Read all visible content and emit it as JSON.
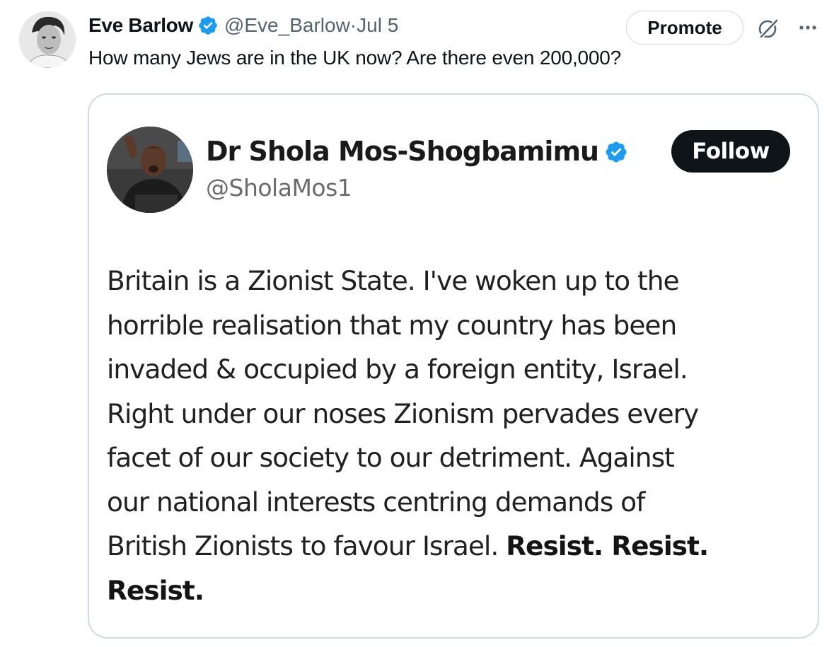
{
  "tweet": {
    "author_name": "Eve Barlow",
    "author_handle": "@Eve_Barlow",
    "separator": "·",
    "date": "Jul 5",
    "text": "How many Jews are in the UK now? Are there even 200,000?",
    "promote_label": "Promote",
    "icons": {
      "verified": "verified-badge-icon",
      "grok": "grok-icon",
      "more": "more-options-icon"
    },
    "colors": {
      "verified": "#1d9bf0",
      "muted": "#536471",
      "border": "#cfd9de"
    }
  },
  "quoted_post": {
    "author_name": "Dr Shola Mos-Shogbamimu",
    "author_handle": "@SholaMos1",
    "follow_label": "Follow",
    "body_lines": [
      "Britain is a Zionist State. I've woken up to the",
      "horrible realisation that my country has been",
      "invaded & occupied by a foreign entity, Israel.",
      "Right under our noses Zionism pervades every",
      "facet of our society to our detriment. Against",
      "our national interests centring demands of"
    ],
    "body_line_7_regular": "British Zionists to favour Israel.",
    "body_line_7_bold": "Resist. Resist.",
    "body_line_8_bold": "Resist."
  }
}
